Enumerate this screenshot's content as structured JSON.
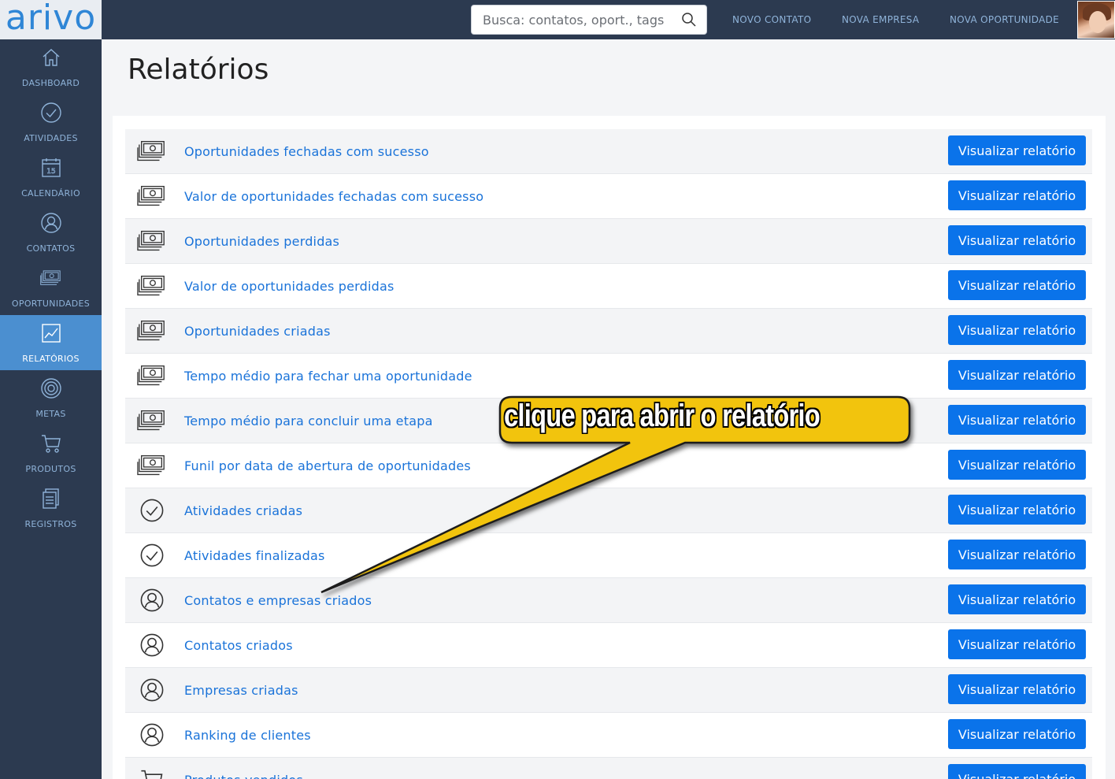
{
  "brand": {
    "logo_text": "arivo",
    "accent": "#2f86d6"
  },
  "sidebar": {
    "items": [
      {
        "label": "DASHBOARD",
        "icon": "home-icon",
        "active": false
      },
      {
        "label": "ATIVIDADES",
        "icon": "check-circle-icon",
        "active": false
      },
      {
        "label": "CALENDÁRIO",
        "icon": "calendar-icon",
        "active": false,
        "icon_text": "15"
      },
      {
        "label": "CONTATOS",
        "icon": "person-icon",
        "active": false
      },
      {
        "label": "OPORTUNIDADES",
        "icon": "money-icon",
        "active": false
      },
      {
        "label": "RELATÓRIOS",
        "icon": "chart-icon",
        "active": true
      },
      {
        "label": "METAS",
        "icon": "target-icon",
        "active": false
      },
      {
        "label": "PRODUTOS",
        "icon": "cart-icon",
        "active": false
      },
      {
        "label": "REGISTROS",
        "icon": "records-icon",
        "active": false
      }
    ]
  },
  "topbar": {
    "search_placeholder": "Busca: contatos, oport., tags",
    "links": [
      "NOVO CONTATO",
      "NOVA EMPRESA",
      "NOVA OPORTUNIDADE"
    ]
  },
  "page": {
    "title": "Relatórios"
  },
  "reports": [
    {
      "label": "Oportunidades fechadas com sucesso",
      "icon": "money-icon",
      "button": "Visualizar relatório"
    },
    {
      "label": "Valor de oportunidades fechadas com sucesso",
      "icon": "money-icon",
      "button": "Visualizar relatório"
    },
    {
      "label": "Oportunidades perdidas",
      "icon": "money-icon",
      "button": "Visualizar relatório"
    },
    {
      "label": "Valor de oportunidades perdidas",
      "icon": "money-icon",
      "button": "Visualizar relatório"
    },
    {
      "label": "Oportunidades criadas",
      "icon": "money-icon",
      "button": "Visualizar relatório"
    },
    {
      "label": "Tempo médio para fechar uma oportunidade",
      "icon": "money-icon",
      "button": "Visualizar relatório"
    },
    {
      "label": "Tempo médio para concluir uma etapa",
      "icon": "money-icon",
      "button": "Visualizar relatório"
    },
    {
      "label": "Funil por data de abertura de oportunidades",
      "icon": "money-icon",
      "button": "Visualizar relatório"
    },
    {
      "label": "Atividades criadas",
      "icon": "check-circle-icon",
      "button": "Visualizar relatório"
    },
    {
      "label": "Atividades finalizadas",
      "icon": "check-circle-icon",
      "button": "Visualizar relatório"
    },
    {
      "label": "Contatos e empresas criados",
      "icon": "person-icon",
      "button": "Visualizar relatório"
    },
    {
      "label": "Contatos criados",
      "icon": "person-icon",
      "button": "Visualizar relatório"
    },
    {
      "label": "Empresas criadas",
      "icon": "person-icon",
      "button": "Visualizar relatório"
    },
    {
      "label": "Ranking de clientes",
      "icon": "person-icon",
      "button": "Visualizar relatório"
    },
    {
      "label": "Produtos vendidos",
      "icon": "cart-icon",
      "button": "Visualizar relatório"
    }
  ],
  "annotation": {
    "text": "clique para abrir o relatório",
    "color": "#f2c40f"
  }
}
